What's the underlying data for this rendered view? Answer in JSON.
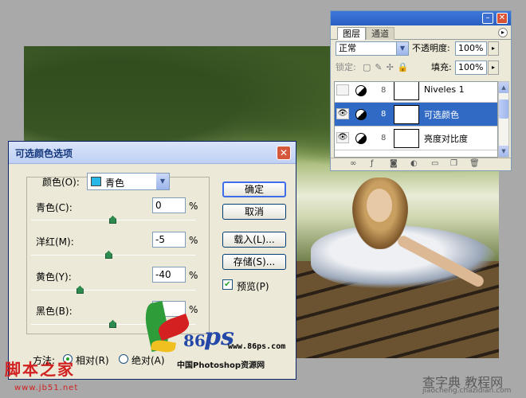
{
  "layers_panel": {
    "tab_layers": "图层",
    "tab_channels": "通道",
    "blend_mode": "正常",
    "opacity_label": "不透明度:",
    "opacity_value": "100%",
    "lock_label": "锁定:",
    "fill_label": "填充:",
    "fill_value": "100%",
    "layers": [
      {
        "name": "Niveles 1",
        "visible": false,
        "selected": false
      },
      {
        "name": "可选颜色",
        "visible": true,
        "selected": true
      },
      {
        "name": "亮度对比度",
        "visible": true,
        "selected": false
      }
    ]
  },
  "dialog": {
    "title": "可选颜色选项",
    "colors_label": "颜色(O):",
    "colors_value": "青色",
    "swatch_color": "#27b7e6",
    "sliders": [
      {
        "label": "青色(C):",
        "value": "0",
        "unit": "%",
        "position": 0.5
      },
      {
        "label": "洋红(M):",
        "value": "-5",
        "unit": "%",
        "position": 0.475
      },
      {
        "label": "黄色(Y):",
        "value": "-40",
        "unit": "%",
        "position": 0.3
      },
      {
        "label": "黑色(B):",
        "value": "0",
        "unit": "%",
        "position": 0.5
      }
    ],
    "buttons": {
      "ok": "确定",
      "cancel": "取消",
      "load": "载入(L)...",
      "save": "存储(S)..."
    },
    "preview_label": "预览(P)",
    "preview_checked": true,
    "method_label": "方法:",
    "method_relative": "相对(R)",
    "method_absolute": "绝对(A)",
    "method_selected": "relative"
  },
  "watermarks": {
    "logo_num": "86",
    "logo_ps": "ps",
    "logo_url": "www.86ps.com",
    "logo_caption": "中国Photoshop资源网",
    "left_text": "脚本之家",
    "left_url": "www.jb51.net",
    "right_text": "查字典 教程网",
    "right_url": "jiaocheng.chazidian.com"
  }
}
